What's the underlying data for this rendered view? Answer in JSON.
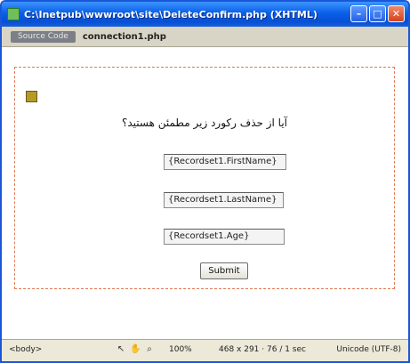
{
  "window": {
    "title": "C:\\Inetpub\\wwwroot\\site\\DeleteConfirm.php (XHTML)",
    "controls": {
      "minimize": "–",
      "maximize": "□",
      "close": "✕"
    }
  },
  "tabs": {
    "source_button": "Source Code",
    "file": "connection1.php"
  },
  "form": {
    "question": "آیا از حذف رکورد زیر مطمئن هستید؟",
    "fields": [
      "{Recordset1.FirstName}",
      "{Recordset1.LastName}",
      "{Recordset1.Age}"
    ],
    "submit_label": "Submit"
  },
  "status": {
    "tag": "<body>",
    "tool_icons": [
      "pointer-icon",
      "hand-icon",
      "zoom-icon"
    ],
    "zoom": "100%",
    "size": "468 x 291",
    "file_info": "76 / 1 sec",
    "encoding": "Unicode (UTF-8)"
  }
}
